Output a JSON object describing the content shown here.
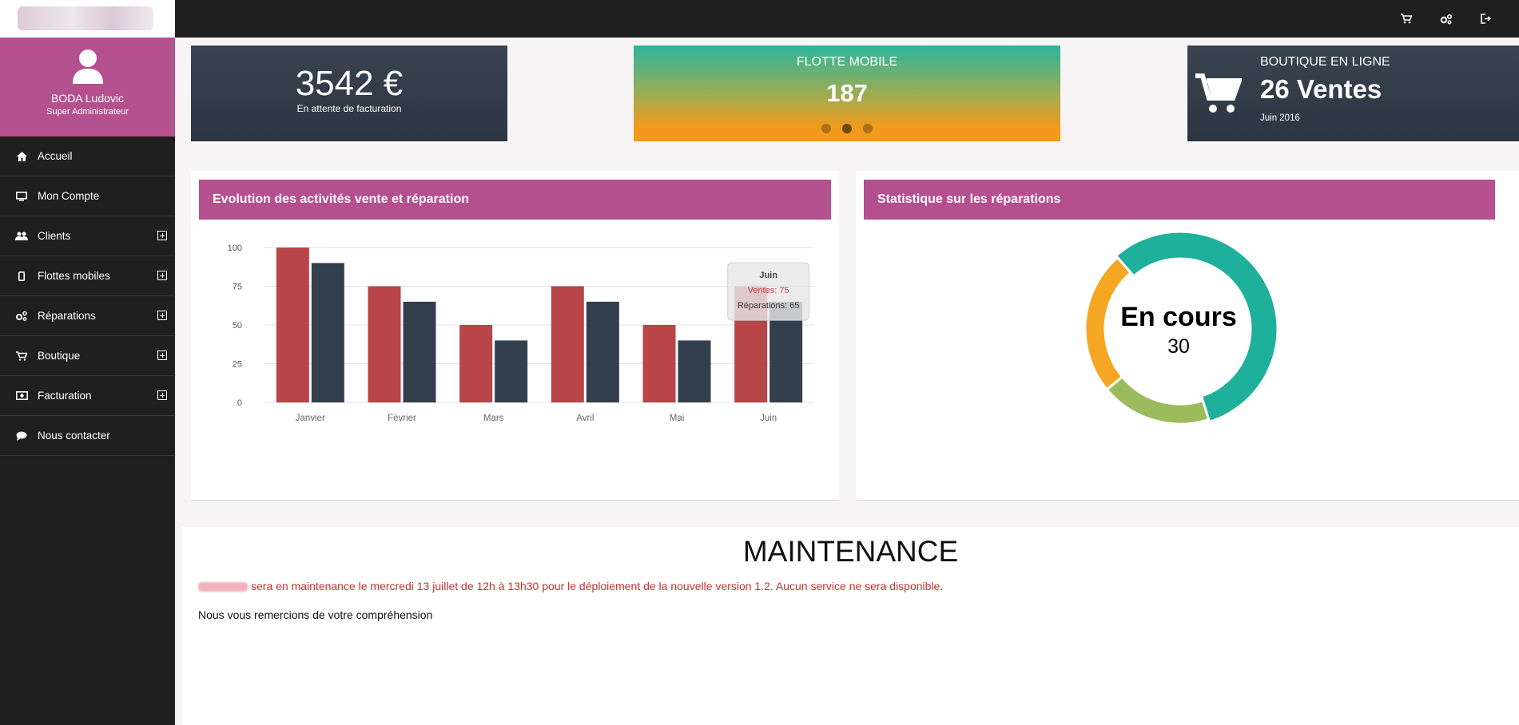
{
  "profile": {
    "name": "BODA Ludovic",
    "role": "Super Administrateur"
  },
  "menu": [
    {
      "label": "Accueil",
      "icon": "home-icon",
      "expandable": false
    },
    {
      "label": "Mon Compte",
      "icon": "monitor-icon",
      "expandable": false
    },
    {
      "label": "Clients",
      "icon": "users-icon",
      "expandable": true
    },
    {
      "label": "Flottes mobiles",
      "icon": "mobile-icon",
      "expandable": true
    },
    {
      "label": "Réparations",
      "icon": "gears-icon",
      "expandable": true
    },
    {
      "label": "Boutique",
      "icon": "cart-icon",
      "expandable": true
    },
    {
      "label": "Facturation",
      "icon": "money-icon",
      "expandable": true
    },
    {
      "label": "Nous contacter",
      "icon": "chat-icon",
      "expandable": false
    }
  ],
  "topbar": {
    "icons": [
      "cart-icon",
      "gears-icon",
      "logout-icon"
    ]
  },
  "kpi": {
    "billing": {
      "value": "3542 €",
      "label": "En attente de facturation"
    },
    "fleet": {
      "title": "FLOTTE MOBILE",
      "value": "187",
      "active_dot": 1
    },
    "shop": {
      "title": "BOUTIQUE EN LIGNE",
      "value": "26 Ventes",
      "date": "Juin 2016"
    }
  },
  "cards": {
    "activity_title": "Evolution des activités vente et réparation",
    "repairs_title": "Statistique sur les réparations"
  },
  "chart_data": [
    {
      "type": "bar",
      "categories": [
        "Janvier",
        "Février",
        "Mars",
        "Avril",
        "Mai",
        "Juin"
      ],
      "series": [
        {
          "name": "Ventes",
          "values": [
            100,
            75,
            50,
            75,
            50,
            75
          ],
          "color": "#b84547"
        },
        {
          "name": "Réparations",
          "values": [
            90,
            65,
            40,
            65,
            40,
            65
          ],
          "color": "#333f4d"
        }
      ],
      "ylim": [
        0,
        100
      ],
      "yticks": [
        0,
        25,
        50,
        75,
        100
      ],
      "grid": true,
      "tooltip": {
        "title": "Juin",
        "lines": [
          "Ventes: 75",
          "Réparations: 65"
        ]
      }
    },
    {
      "type": "pie",
      "donut": true,
      "slices": [
        {
          "value": 30,
          "color": "#1fb09b"
        },
        {
          "value": 10,
          "color": "#9bbb5c"
        },
        {
          "value": 13,
          "color": "#f5a623"
        }
      ],
      "center_label": "En cours",
      "center_value": "30"
    }
  ],
  "maintenance": {
    "title": "MAINTENANCE",
    "message": "sera en maintenance le mercredi 13 juillet de 12h à 13h30 pour le déploiement de la nouvelle version 1.2. Aucun service ne sera disponible.",
    "thanks": "Nous vous remercions de votre compréhension"
  }
}
